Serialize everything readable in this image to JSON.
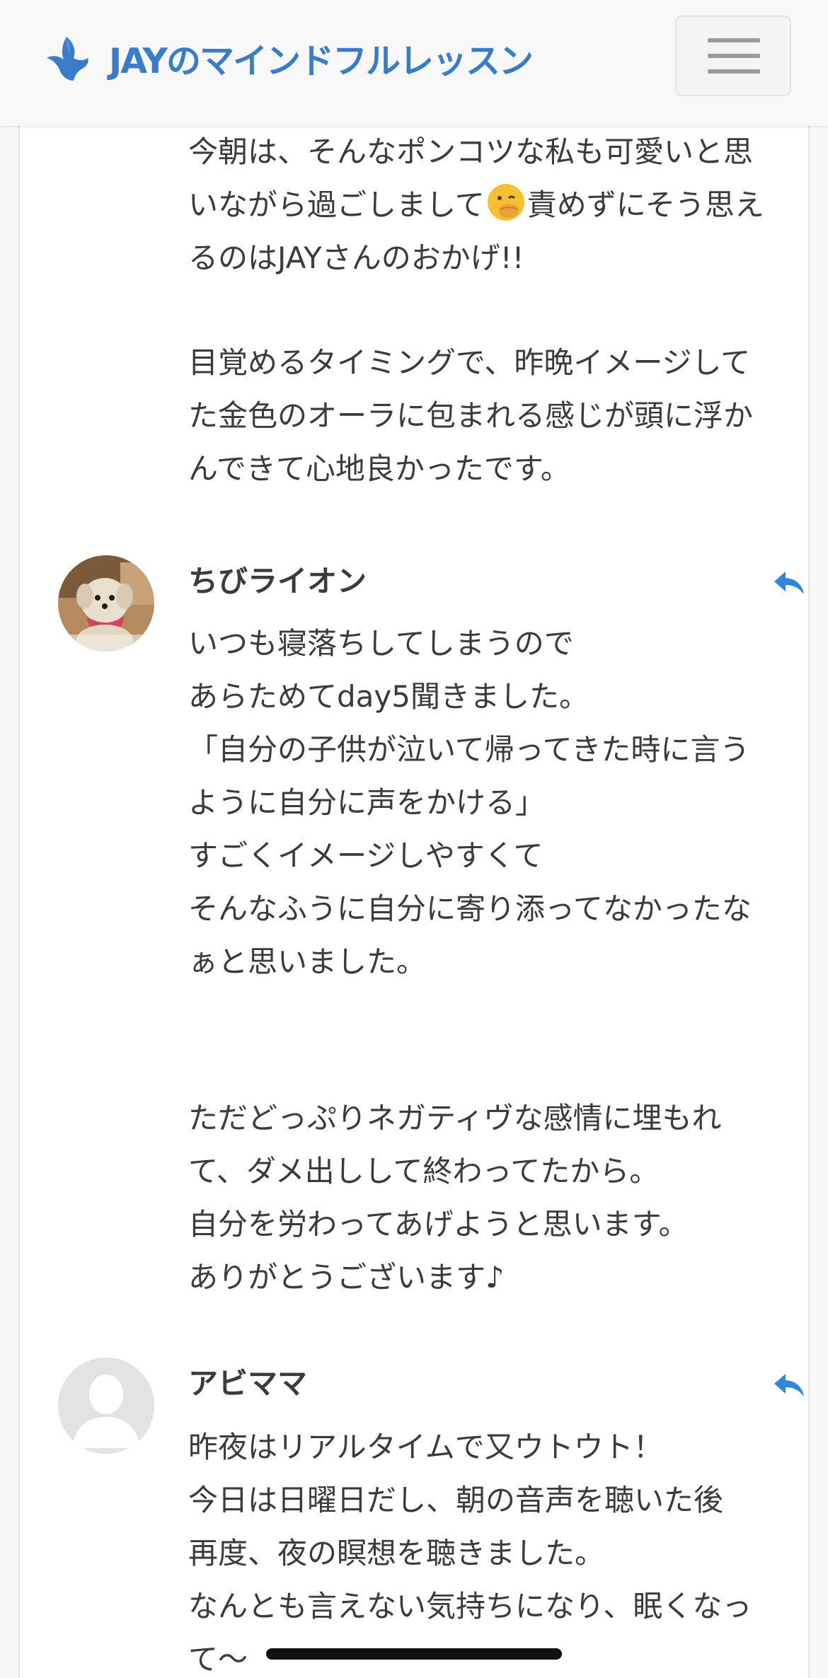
{
  "header": {
    "logo_text": "JAYのマインドフルレッスン",
    "brand_color": "#3a7cc7",
    "menu_icon": "hamburger-icon"
  },
  "comments": [
    {
      "body_line1": "今朝は、そんなポンコツな私も可愛いと思",
      "body_line2a": "いながら過ごしまして",
      "emoji": "face-with-hand-over-mouth",
      "body_line2b": "責めずにそう思え",
      "body_line3": "るのはJAYさんのおかげ!!",
      "body_rest": "目覚めるタイミングで、昨晩イメージして\nた金色のオーラに包まれる感じが頭に浮か\nんできて心地良かったです。"
    },
    {
      "author": "ちびライオン",
      "avatar": "dog-photo-avatar",
      "body": "いつも寝落ちしてしまうので\nあらためてday5聞きました。\n「自分の子供が泣いて帰ってきた時に言う\nように自分に声をかける」\nすごくイメージしやすくて\nそんなふうに自分に寄り添ってなかったな\nぁと思いました。",
      "body2": "ただどっぷりネガティヴな感情に埋もれ\nて、ダメ出しして終わってたから。\n自分を労わってあげようと思います。\nありがとうございます♪",
      "reply_icon": "reply-icon"
    },
    {
      "author": "アビママ",
      "avatar": "default-avatar",
      "body": "昨夜はリアルタイムで又ウトウト！\n今日は日曜日だし、朝の音声を聴いた後\n再度、夜の瞑想を聴きました。\nなんとも言えない気持ちになり、眠くなっ\nて〜",
      "reply_icon": "reply-icon"
    }
  ]
}
